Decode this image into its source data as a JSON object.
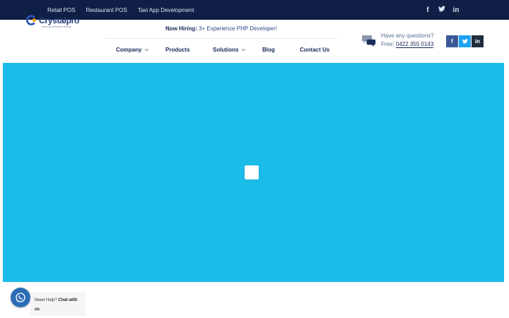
{
  "topbar": {
    "links": [
      "Retail POS",
      "Restaurant POS",
      "Taxi App Development"
    ],
    "social_icons": [
      "facebook-icon",
      "twitter-icon",
      "linkedin-icon"
    ],
    "social_glyphs": [
      "f",
      "t",
      "in"
    ],
    "background": "#0f1f45"
  },
  "logo": {
    "name": "Crystalpro",
    "tagline": "serving software simply"
  },
  "hiring": {
    "label": "Now Hiring:",
    "text": "3+ Experience PHP Developer!"
  },
  "nav": {
    "company": "Company",
    "products": "Products",
    "solutions": "Solutions",
    "blog": "Blog",
    "contact_us": "Contact Us"
  },
  "contact": {
    "question": "Have any questions?",
    "free_label": "Free:",
    "phone": "0422 355 0143"
  },
  "header_social": {
    "facebook": "f",
    "twitter": "t",
    "linkedin": "in"
  },
  "hero": {
    "background": "#1bbcea"
  },
  "chat": {
    "need_help": "Need Help?",
    "chat_with": "Chat with",
    "us": "us"
  }
}
